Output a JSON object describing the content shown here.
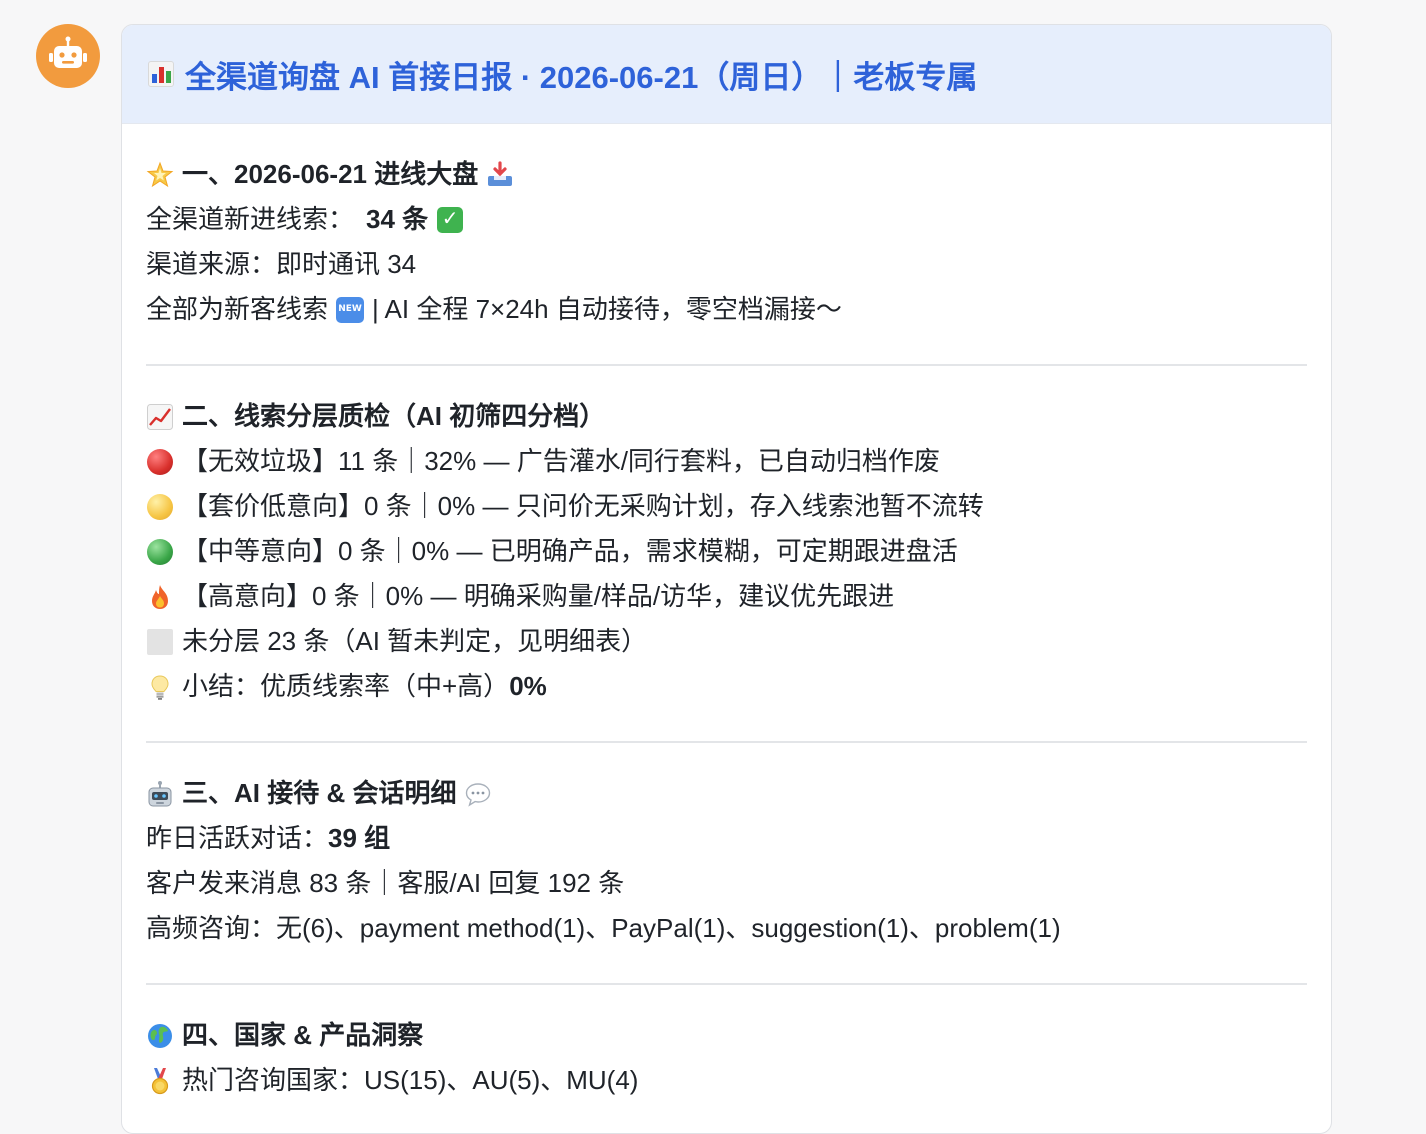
{
  "bot": {
    "avatar_icon": "robot-icon",
    "avatar_color": "#f29b3e"
  },
  "header": {
    "icon": "bar-chart-icon",
    "title": "全渠道询盘 AI 首接日报 · 2026-06-21（周日）｜老板专属",
    "background": "#e6eefc",
    "color": "#2e62d9"
  },
  "section1": {
    "heading": "一、2026-06-21 进线大盘",
    "heading_icon": "star-icon",
    "heading_trail_icon": "inbox-tray-icon",
    "new_leads_label": "全渠道新进线索：",
    "new_leads_value": "34 条",
    "new_leads_icon": "check-mark-icon",
    "source_line": "渠道来源：即时通讯 34",
    "newcust_prefix": "全部为新客线索",
    "newcust_icon": "new-badge-icon",
    "newcust_suffix": "| AI 全程 7×24h 自动接待，零空档漏接～"
  },
  "section2": {
    "heading": "二、线索分层质检（AI 初筛四分档）",
    "heading_icon": "trend-chart-icon",
    "tiers": [
      {
        "icon": "red-circle-icon",
        "color": "#d9302c",
        "text": "【无效垃圾】11 条｜32% — 广告灌水/同行套料，已自动归档作废"
      },
      {
        "icon": "yellow-circle-icon",
        "color": "#f6c544",
        "text": "【套价低意向】0 条｜0% — 只问价无采购计划，存入线索池暂不流转"
      },
      {
        "icon": "green-circle-icon",
        "color": "#3aa648",
        "text": "【中等意向】0 条｜0% — 已明确产品，需求模糊，可定期跟进盘活"
      },
      {
        "icon": "fire-icon",
        "color": "#f0642a",
        "text": "【高意向】0 条｜0% — 明确采购量/样品/访华，建议优先跟进"
      }
    ],
    "unclassified_icon": "gray-square-icon",
    "unclassified": "未分层 23 条（AI 暂未判定，见明细表）",
    "summary_icon": "light-bulb-icon",
    "summary_label": "小结：优质线索率（中+高）",
    "summary_value": "0%"
  },
  "section3": {
    "heading": "三、AI 接待 & 会话明细",
    "heading_icon": "robot-icon",
    "heading_trail_icon": "speech-bubble-icon",
    "active_label": "昨日活跃对话：",
    "active_value": "39 组",
    "messages": "客户发来消息 83 条｜客服/AI 回复 192 条",
    "faq": "高频咨询：无(6)、payment method(1)、PayPal(1)、suggestion(1)、problem(1)"
  },
  "section4": {
    "heading": "四、国家 & 产品洞察",
    "heading_icon": "globe-icon",
    "countries_icon": "gold-medal-icon",
    "countries": "热门咨询国家：US(15)、AU(5)、MU(4)"
  }
}
